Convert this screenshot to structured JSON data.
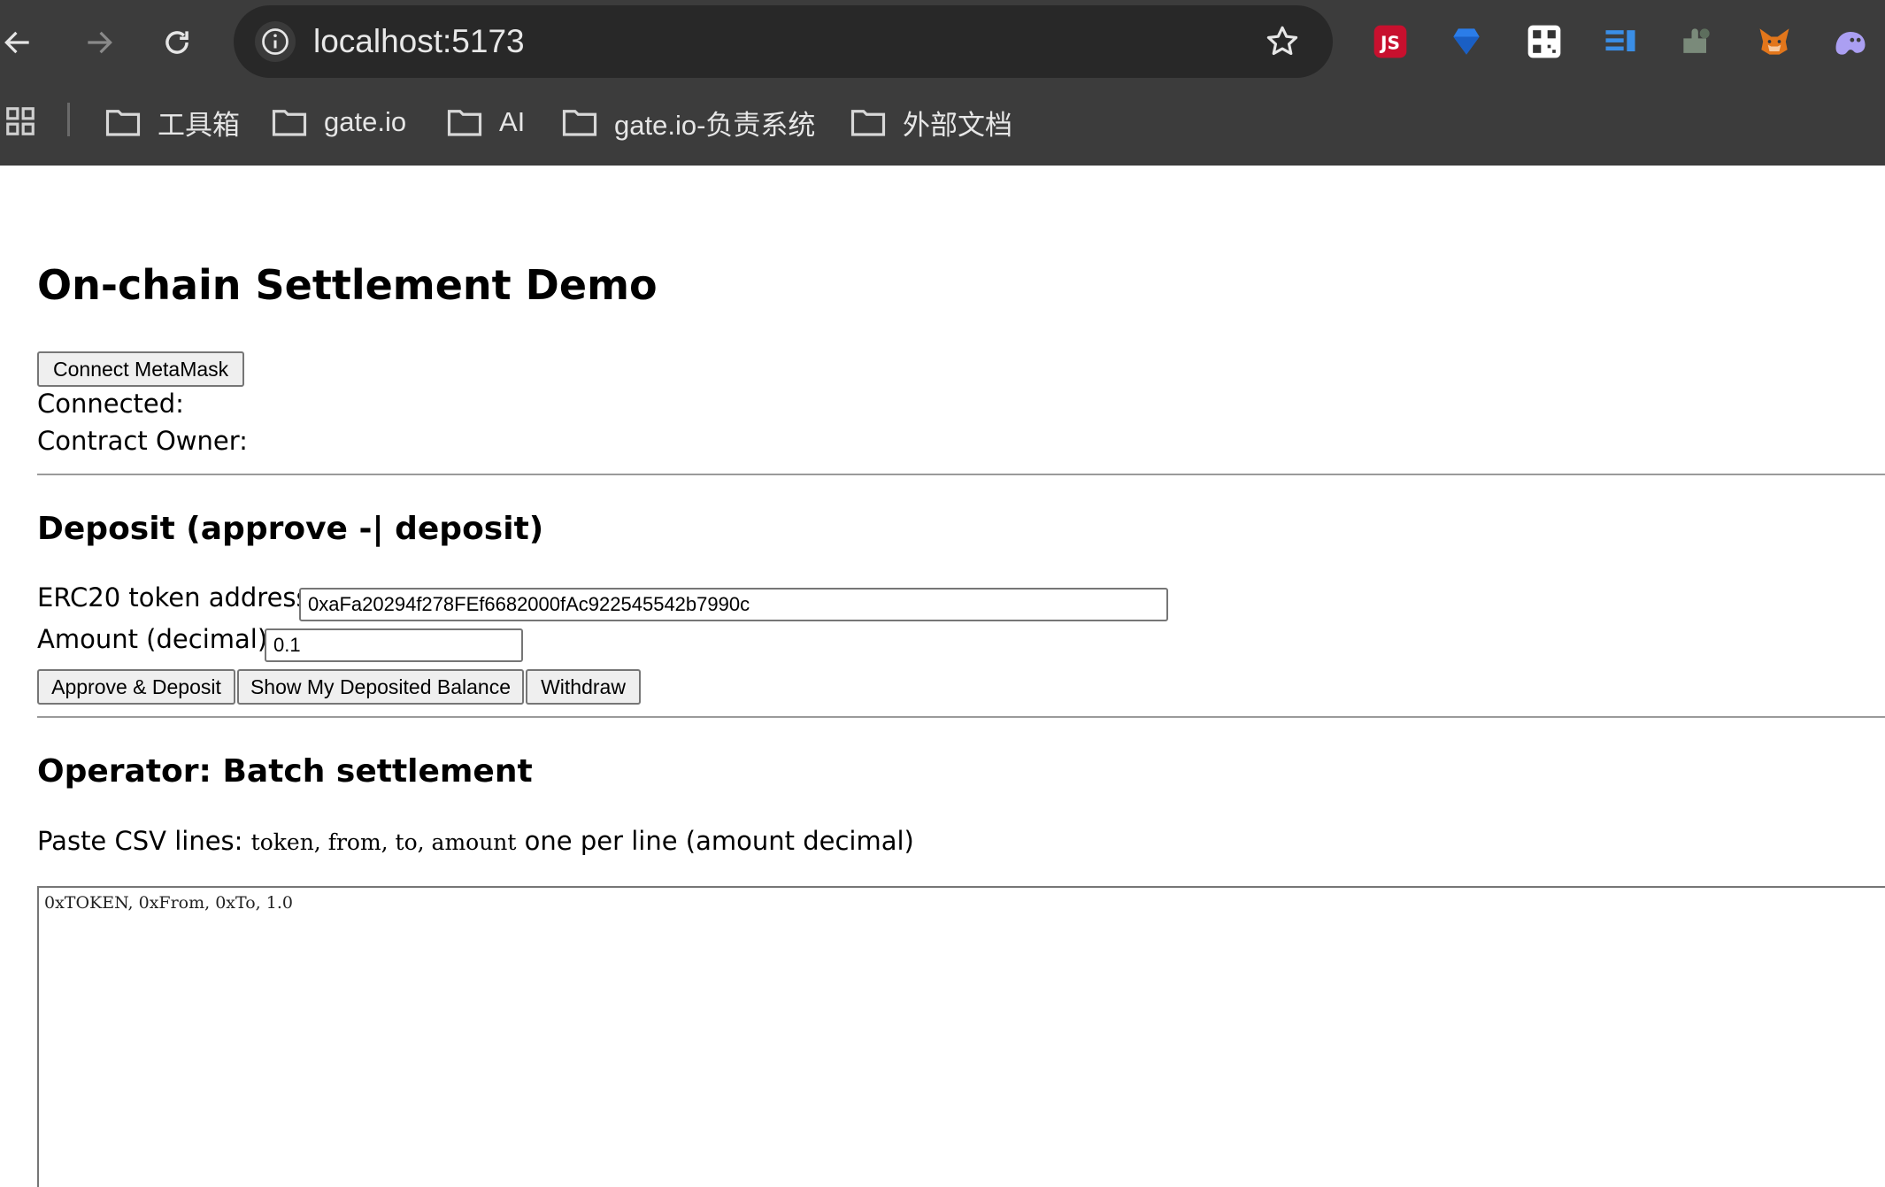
{
  "browser": {
    "url": "localhost:5173",
    "nav": {
      "back": "arrow-left-icon",
      "forward": "arrow-right-icon",
      "reload": "reload-icon"
    },
    "extensions": [
      {
        "name": "js-extension-icon",
        "label": "JS",
        "color": "#c8102e"
      },
      {
        "name": "diamond-extension-icon",
        "color": "#2b7de9"
      },
      {
        "name": "qr-code-extension-icon",
        "color": "#ffffff"
      },
      {
        "name": "reader-extension-icon",
        "color": "#3a8ee6"
      },
      {
        "name": "puzzle-extension-icon",
        "color": "#7a8a7a"
      },
      {
        "name": "metamask-fox-icon",
        "color": "#e2761b"
      },
      {
        "name": "ghost-extension-icon",
        "color": "#ab9ff2"
      }
    ],
    "bookmarks": [
      {
        "label": "工具箱"
      },
      {
        "label": "gate.io"
      },
      {
        "label": "AI"
      },
      {
        "label": "gate.io-负责系统"
      },
      {
        "label": "外部文档"
      }
    ]
  },
  "page": {
    "title": "On-chain Settlement Demo",
    "connect_button": "Connect MetaMask",
    "connected_label": "Connected:",
    "owner_label": "Contract Owner:",
    "deposit": {
      "heading": "Deposit (approve -| deposit)",
      "token_label": "ERC20 token address:",
      "token_value": "0xaFa20294f278FEf6682000fAc922545542b7990c",
      "amount_label": "Amount (decimal):",
      "amount_value": "0.1",
      "approve_button": "Approve & Deposit",
      "balance_button": "Show My Deposited Balance",
      "withdraw_button": "Withdraw"
    },
    "operator": {
      "heading": "Operator: Batch settlement",
      "csv_prefix": "Paste CSV lines: ",
      "csv_format": "token, from, to, amount",
      "csv_suffix": " one per line (amount decimal)",
      "textarea_value": "0xTOKEN, 0xFrom, 0xTo, 1.0"
    }
  }
}
